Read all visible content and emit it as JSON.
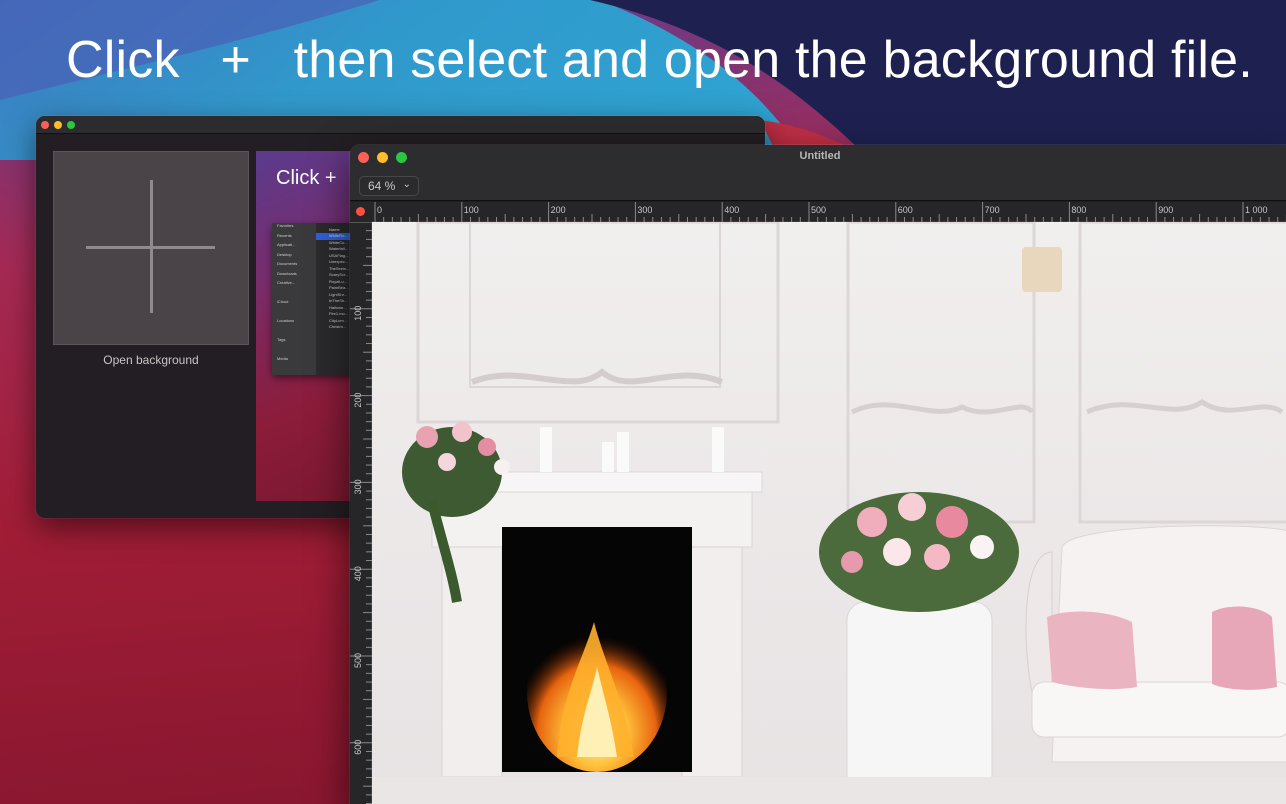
{
  "headline": {
    "prefix": "Click",
    "plus": "+",
    "suffix": "then select and open the background file."
  },
  "back_window": {
    "open_tile_label": "Open background",
    "thumbnail": {
      "title": "Click  +",
      "sidebar_items": [
        "Favorites",
        "Recents",
        "Applicati...",
        "Desktop",
        "Documents",
        "Downloads",
        "Creative...",
        "",
        "iCloud",
        "",
        "Locations",
        "",
        "Tags",
        "",
        "Media"
      ],
      "list_header": "Name",
      "list_items": [
        "WhiteRo...",
        "WhiteCo...",
        "WaterfalI...",
        "USAFlag...",
        "Unexpec...",
        "TheSeein...",
        "ScaryScr...",
        "RoyalLu...",
        "PalmBea...",
        "LightShr...",
        "InTheSh...",
        "Hallowe...",
        "Fire1.mo...",
        "CityLum...",
        "Christm..."
      ]
    }
  },
  "front_window": {
    "title": "Untitled",
    "zoom": "64 %",
    "ruler_h_labels": [
      "0",
      "100",
      "200",
      "300",
      "400",
      "500",
      "600",
      "700",
      "800",
      "900",
      "1 000"
    ],
    "ruler_v_labels": [
      "100",
      "200",
      "300",
      "400",
      "500",
      "600"
    ]
  },
  "colors": {
    "traffic_red": "#fe5f57",
    "traffic_yellow": "#febc2e",
    "traffic_green": "#28c840",
    "selection_blue": "#2f61d6"
  }
}
